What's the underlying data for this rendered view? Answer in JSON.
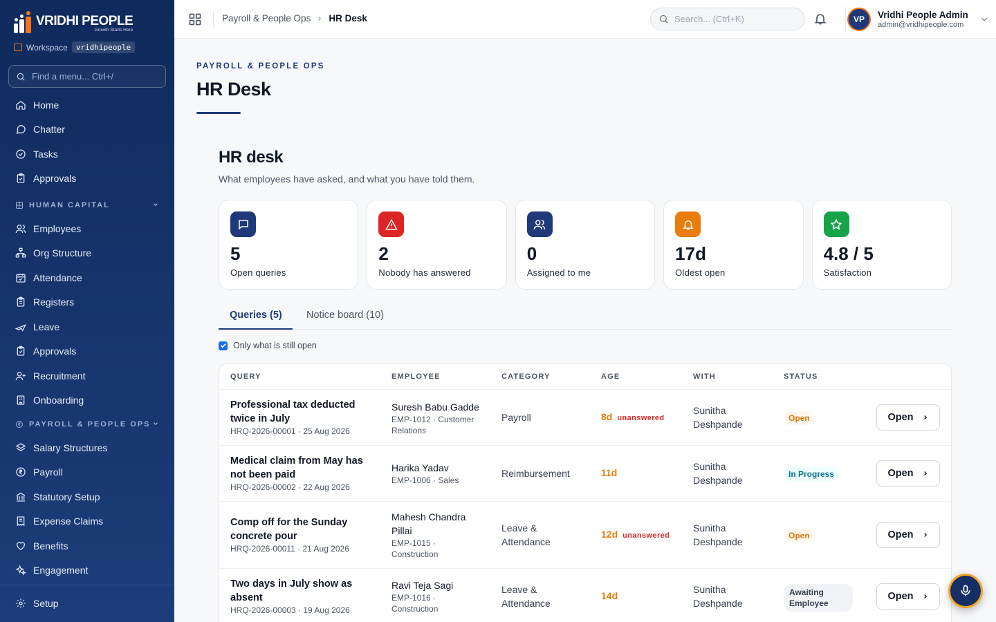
{
  "brand": {
    "name": "VRIDHI PEOPLE",
    "tagline": "Growth Starts Here"
  },
  "workspace": {
    "label": "Workspace",
    "value": "vridhipeople"
  },
  "side_search": {
    "placeholder": "Find a menu... Ctrl+/"
  },
  "nav": {
    "top": [
      {
        "label": "Home",
        "icon": "home-icon"
      },
      {
        "label": "Chatter",
        "icon": "chat-icon"
      },
      {
        "label": "Tasks",
        "icon": "check-circle-icon"
      },
      {
        "label": "Approvals",
        "icon": "clipboard-check-icon"
      }
    ],
    "human_capital": {
      "title": "HUMAN CAPITAL",
      "items": [
        {
          "label": "Employees",
          "icon": "users-icon"
        },
        {
          "label": "Org Structure",
          "icon": "org-chart-icon"
        },
        {
          "label": "Attendance",
          "icon": "calendar-check-icon"
        },
        {
          "label": "Registers",
          "icon": "clipboard-list-icon"
        },
        {
          "label": "Leave",
          "icon": "plane-icon"
        },
        {
          "label": "Approvals",
          "icon": "clipboard-check-icon"
        },
        {
          "label": "Recruitment",
          "icon": "user-plus-icon"
        },
        {
          "label": "Onboarding",
          "icon": "building-icon"
        }
      ]
    },
    "payroll": {
      "title": "PAYROLL & PEOPLE OPS",
      "items": [
        {
          "label": "Salary Structures",
          "icon": "layers-icon"
        },
        {
          "label": "Payroll",
          "icon": "rupee-coin-icon"
        },
        {
          "label": "Statutory Setup",
          "icon": "landmark-icon"
        },
        {
          "label": "Expense Claims",
          "icon": "receipt-icon"
        },
        {
          "label": "Benefits",
          "icon": "heart-handshake-icon"
        },
        {
          "label": "Engagement",
          "icon": "sparkles-icon"
        }
      ]
    },
    "setup": {
      "label": "Setup",
      "icon": "gear-icon"
    }
  },
  "topbar": {
    "breadcrumb": [
      "Payroll & People Ops",
      "HR Desk"
    ],
    "search_placeholder": "Search... (Ctrl+K)",
    "user": {
      "initials": "VP",
      "name": "Vridhi People Admin",
      "email": "admin@vridhipeople.com"
    }
  },
  "page": {
    "eyebrow": "PAYROLL & PEOPLE OPS",
    "title": "HR Desk",
    "section_title": "HR desk",
    "section_subtitle": "What employees have asked, and what you have told them."
  },
  "stats": [
    {
      "value": "5",
      "label": "Open queries",
      "icon": "message-square-icon",
      "color": "#1e3a7a"
    },
    {
      "value": "2",
      "label": "Nobody has answered",
      "icon": "alert-triangle-icon",
      "color": "#dc2626"
    },
    {
      "value": "0",
      "label": "Assigned to me",
      "icon": "users-icon",
      "color": "#1e3a7a"
    },
    {
      "value": "17d",
      "label": "Oldest open",
      "icon": "bell-icon",
      "color": "#ea7c0c"
    },
    {
      "value": "4.8 / 5",
      "label": "Satisfaction",
      "icon": "star-icon",
      "color": "#16a34a"
    }
  ],
  "tabs": [
    {
      "label": "Queries (5)",
      "active": true
    },
    {
      "label": "Notice board (10)",
      "active": false
    }
  ],
  "filter": {
    "label": "Only what is still open",
    "checked": true
  },
  "table": {
    "columns": [
      "QUERY",
      "EMPLOYEE",
      "CATEGORY",
      "AGE",
      "WITH",
      "STATUS"
    ],
    "action_label": "Open",
    "rows": [
      {
        "title": "Professional tax deducted twice in July",
        "meta": "HRQ-2026-00001 · 25 Aug 2026",
        "employee": "Suresh Babu Gadde",
        "emp_meta": "EMP-1012 · Customer Relations",
        "category": "Payroll",
        "age": "8d",
        "flag": "unanswered",
        "with": "Sunitha Deshpande",
        "status": "Open"
      },
      {
        "title": "Medical claim from May has not been paid",
        "meta": "HRQ-2026-00002 · 22 Aug 2026",
        "employee": "Harika Yadav",
        "emp_meta": "EMP-1006 · Sales",
        "category": "Reimbursement",
        "age": "11d",
        "flag": "",
        "with": "Sunitha Deshpande",
        "status": "In Progress"
      },
      {
        "title": "Comp off for the Sunday concrete pour",
        "meta": "HRQ-2026-00011 · 21 Aug 2026",
        "employee": "Mahesh Chandra Pillai",
        "emp_meta": "EMP-1015 · Construction",
        "category": "Leave & Attendance",
        "age": "12d",
        "flag": "unanswered",
        "with": "Sunitha Deshpande",
        "status": "Open"
      },
      {
        "title": "Two days in July show as absent",
        "meta": "HRQ-2026-00003 · 19 Aug 2026",
        "employee": "Ravi Teja Sagi",
        "emp_meta": "EMP-1016 · Construction",
        "category": "Leave & Attendance",
        "age": "14d",
        "flag": "",
        "with": "Sunitha Deshpande",
        "status": "Awaiting Employee"
      }
    ]
  },
  "colors": {
    "sidebar": "#0f2a5c",
    "accent": "#1e3a7a",
    "brand_orange": "#f97316",
    "age": "#ea7c0c",
    "danger": "#dc2626"
  }
}
